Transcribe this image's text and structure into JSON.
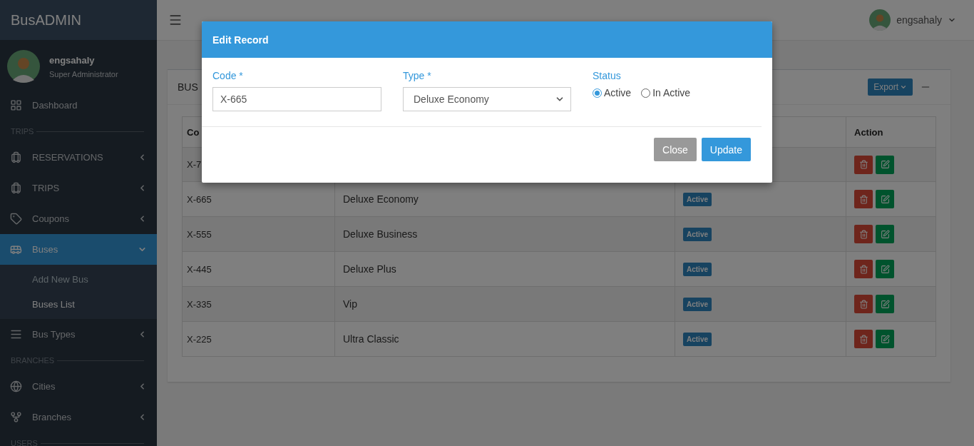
{
  "brand": "BusADMIN",
  "profile": {
    "name": "engsahaly",
    "role": "Super Administrator"
  },
  "sidebar": {
    "items": [
      {
        "kind": "link",
        "label": "Dashboard",
        "selected": false
      },
      {
        "kind": "header",
        "label": "TRIPS"
      },
      {
        "kind": "menu",
        "label": "RESERVATIONS",
        "selected": false,
        "expanded": false
      },
      {
        "kind": "menu",
        "label": "TRIPS",
        "selected": false,
        "expanded": false
      },
      {
        "kind": "menu",
        "label": "Coupons",
        "selected": false,
        "expanded": false
      },
      {
        "kind": "menu",
        "label": "Buses",
        "selected": true,
        "expanded": true,
        "children": [
          {
            "label": "Add New Bus",
            "selected": false
          },
          {
            "label": "Buses List",
            "selected": true
          }
        ]
      },
      {
        "kind": "menu",
        "label": "Bus Types",
        "selected": false,
        "expanded": false
      },
      {
        "kind": "header",
        "label": "BRANCHES"
      },
      {
        "kind": "menu",
        "label": "Cities",
        "selected": false,
        "expanded": false
      },
      {
        "kind": "menu",
        "label": "Branches",
        "selected": false,
        "expanded": false
      },
      {
        "kind": "header",
        "label": "USERS"
      }
    ]
  },
  "navbar": {
    "user": "engsahaly"
  },
  "card": {
    "title": "BUS",
    "export_button": "Export"
  },
  "table": {
    "header": {
      "column_1": "Co",
      "column_4": "Action"
    },
    "rows": [
      {
        "code": "X-7"
      },
      {
        "code": "X-665",
        "type": "Deluxe Economy",
        "status": "Active"
      },
      {
        "code": "X-555",
        "type": "Deluxe Business",
        "status": "Active"
      },
      {
        "code": "X-445",
        "type": "Deluxe Plus",
        "status": "Active"
      },
      {
        "code": "X-335",
        "type": "Vip",
        "status": "Active"
      },
      {
        "code": "X-225",
        "type": "Ultra Classic",
        "status": "Active"
      }
    ]
  },
  "modal": {
    "title": "Edit Record",
    "code": {
      "label": "Code *",
      "value": "X-665"
    },
    "type": {
      "label": "Type *",
      "value": "Deluxe Economy"
    },
    "status": {
      "label": "Status",
      "options": [
        {
          "label": "Active",
          "selected": true
        },
        {
          "label": "In Active",
          "selected": false
        }
      ]
    },
    "buttons": [
      {
        "kind": "secondary",
        "label": "Close"
      },
      {
        "kind": "primary",
        "label": "Update"
      }
    ]
  }
}
